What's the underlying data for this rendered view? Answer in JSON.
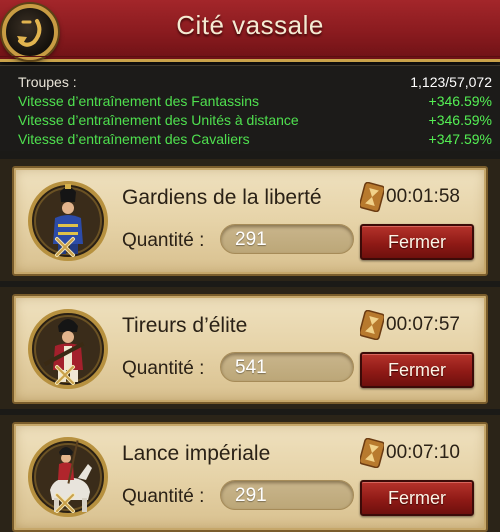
{
  "header": {
    "title": "Cité vassale"
  },
  "stats": [
    {
      "label": "Troupes :",
      "value": "1,123/57,072"
    },
    {
      "label": "Vitesse d’entraînement des Fantassins",
      "value": "+346.59%"
    },
    {
      "label": "Vitesse d’entraînement des Unités à distance",
      "value": "+346.59%"
    },
    {
      "label": "Vitesse d’entraînement des Cavaliers",
      "value": "+347.59%"
    }
  ],
  "units": [
    {
      "name": "Gardiens de la liberté",
      "timer": "00:01:58",
      "quantity_label": "Quantité :",
      "quantity": "291",
      "button": "Fermer"
    },
    {
      "name": "Tireurs d’élite",
      "timer": "00:07:57",
      "quantity_label": "Quantité :",
      "quantity": "541",
      "button": "Fermer"
    },
    {
      "name": "Lance impériale",
      "timer": "00:07:10",
      "quantity_label": "Quantité :",
      "quantity": "291",
      "button": "Fermer"
    }
  ],
  "colors": {
    "header": "#8a1b1f",
    "positive": "#54f054",
    "button": "#8f1a16",
    "card": "#e6d3a8"
  },
  "icons": {
    "back": "back-arrow-icon",
    "timer": "hourglass-icon",
    "rank": "rank-x-icon"
  }
}
